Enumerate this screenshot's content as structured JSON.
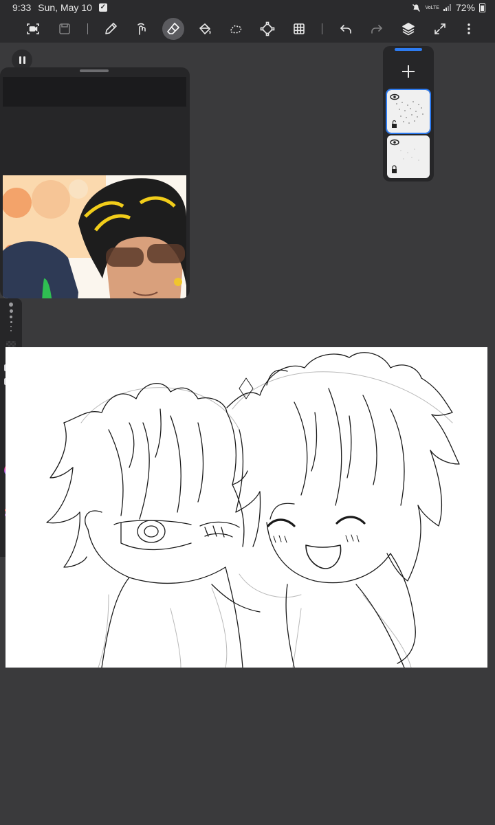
{
  "status_bar": {
    "time": "9:33",
    "date": "Sun, May 10",
    "network": "VoLTE",
    "battery": "72%",
    "icons": [
      "checklist-icon",
      "mute-icon",
      "volte-icon",
      "signal-icon",
      "battery-icon"
    ]
  },
  "toolbar": {
    "tools": [
      {
        "name": "screen-record-icon",
        "state": "normal"
      },
      {
        "name": "save-icon",
        "state": "dimmed"
      },
      {
        "name": "brush-icon",
        "state": "normal"
      },
      {
        "name": "smudge-icon",
        "state": "normal"
      },
      {
        "name": "eraser-icon",
        "state": "active"
      },
      {
        "name": "fill-icon",
        "state": "normal"
      },
      {
        "name": "lasso-icon",
        "state": "normal"
      },
      {
        "name": "transform-icon",
        "state": "normal"
      },
      {
        "name": "grid-icon",
        "state": "normal"
      },
      {
        "name": "undo-icon",
        "state": "normal"
      },
      {
        "name": "redo-icon",
        "state": "dimmed"
      },
      {
        "name": "layers-icon",
        "state": "normal"
      },
      {
        "name": "fullscreen-icon",
        "state": "normal"
      },
      {
        "name": "more-icon",
        "state": "normal"
      }
    ],
    "accent": "#5b5b5f"
  },
  "colors": {
    "app_background": "#3a3a3c",
    "bar_background": "#2b2b2d",
    "selection_blue": "#2d7bf0",
    "canvas": "#ffffff"
  },
  "reference_window": {
    "icon": "reference-image-icon"
  },
  "brush_panel": {
    "icons": [
      "color-wheel-icon",
      "eyedropper-icon",
      "palette-icon",
      "close-icon"
    ]
  },
  "layers_panel": {
    "add_icon": "plus-icon",
    "layers": [
      {
        "visible": true,
        "locked": false,
        "selected": true
      },
      {
        "visible": true,
        "locked": true,
        "selected": false
      }
    ]
  }
}
